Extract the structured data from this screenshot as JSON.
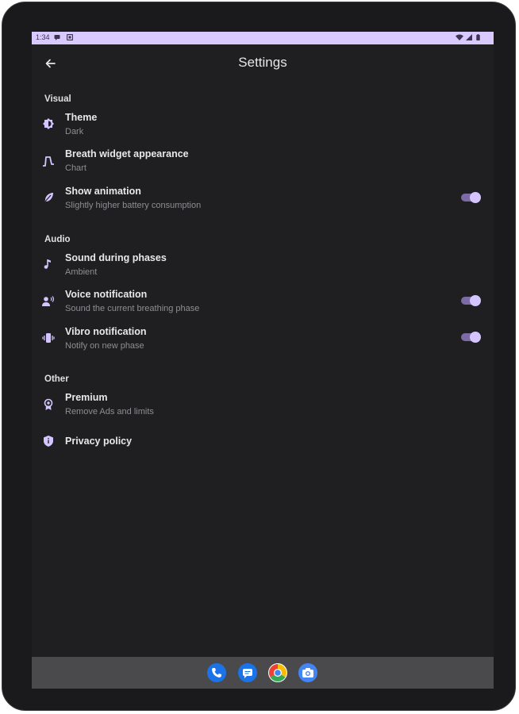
{
  "status_bar": {
    "time": "1:34",
    "left_icons": [
      "message-icon",
      "notification-icon"
    ],
    "right_icons": [
      "wifi-icon",
      "signal-icon",
      "battery-icon"
    ]
  },
  "app_bar": {
    "back_icon": "arrow-left-icon",
    "title": "Settings"
  },
  "sections": {
    "visual": {
      "header": "Visual",
      "theme": {
        "icon": "theme-icon",
        "title": "Theme",
        "subtitle": "Dark"
      },
      "breath_widget": {
        "icon": "chart-pulse-icon",
        "title": "Breath widget appearance",
        "subtitle": "Chart"
      },
      "show_animation": {
        "icon": "feather-icon",
        "title": "Show animation",
        "subtitle": "Slightly higher battery consumption",
        "enabled": true
      }
    },
    "audio": {
      "header": "Audio",
      "sound_during_phases": {
        "icon": "music-note-icon",
        "title": "Sound during phases",
        "subtitle": "Ambient"
      },
      "voice_notification": {
        "icon": "voice-icon",
        "title": "Voice notification",
        "subtitle": "Sound the current breathing phase",
        "enabled": true
      },
      "vibro_notification": {
        "icon": "vibration-icon",
        "title": "Vibro notification",
        "subtitle": "Notify on new phase",
        "enabled": true
      }
    },
    "other": {
      "header": "Other",
      "premium": {
        "icon": "premium-badge-icon",
        "title": "Premium",
        "subtitle": "Remove Ads and limits"
      },
      "privacy_policy": {
        "icon": "shield-icon",
        "title": "Privacy policy"
      }
    }
  },
  "dock": {
    "apps": [
      "phone-icon",
      "messages-icon",
      "chrome-icon",
      "camera-icon"
    ]
  },
  "colors": {
    "accent": "#d4c4ff",
    "accent_track": "#7d6ba6",
    "background": "#1f1f21",
    "status_bar": "#d9c9ff",
    "nav_bar": "#4a4a4c"
  }
}
